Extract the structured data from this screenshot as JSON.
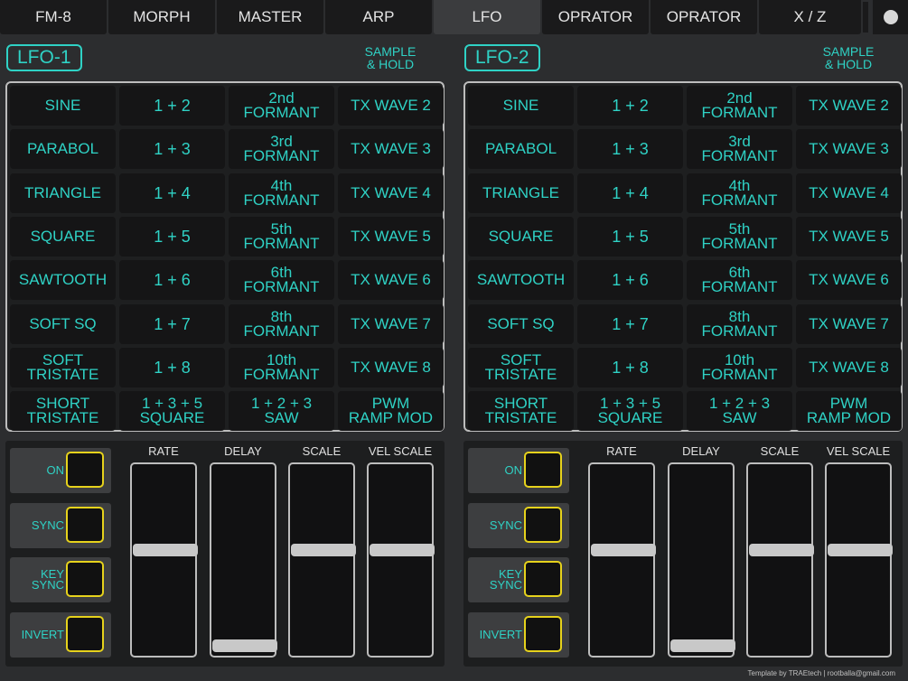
{
  "tabs": [
    {
      "label": "FM-8",
      "active": false
    },
    {
      "label": "MORPH",
      "active": false
    },
    {
      "label": "MASTER",
      "active": false
    },
    {
      "label": "ARP",
      "active": false
    },
    {
      "label": "LFO",
      "active": true
    },
    {
      "label": "OPRATOR",
      "active": false
    },
    {
      "label": "OPRATOR",
      "active": false
    },
    {
      "label": "X / Z",
      "active": false
    }
  ],
  "lfos": [
    {
      "title": "LFO-1",
      "sample_hold": [
        "SAMPLE",
        "& HOLD"
      ],
      "waves": [
        [
          [
            "SINE"
          ],
          [
            "1 + 2"
          ],
          [
            "2nd",
            "FORMANT"
          ],
          [
            "TX WAVE 2"
          ]
        ],
        [
          [
            "PARABOL"
          ],
          [
            "1 + 3"
          ],
          [
            "3rd",
            "FORMANT"
          ],
          [
            "TX WAVE 3"
          ]
        ],
        [
          [
            "TRIANGLE"
          ],
          [
            "1 + 4"
          ],
          [
            "4th",
            "FORMANT"
          ],
          [
            "TX WAVE 4"
          ]
        ],
        [
          [
            "SQUARE"
          ],
          [
            "1 + 5"
          ],
          [
            "5th",
            "FORMANT"
          ],
          [
            "TX WAVE 5"
          ]
        ],
        [
          [
            "SAWTOOTH"
          ],
          [
            "1 + 6"
          ],
          [
            "6th",
            "FORMANT"
          ],
          [
            "TX WAVE 6"
          ]
        ],
        [
          [
            "SOFT SQ"
          ],
          [
            "1 + 7"
          ],
          [
            "8th",
            "FORMANT"
          ],
          [
            "TX WAVE 7"
          ]
        ],
        [
          [
            "SOFT",
            "TRISTATE"
          ],
          [
            "1 + 8"
          ],
          [
            "10th",
            "FORMANT"
          ],
          [
            "TX WAVE 8"
          ]
        ],
        [
          [
            "SHORT",
            "TRISTATE"
          ],
          [
            "1 + 3 + 5",
            "SQUARE"
          ],
          [
            "1 + 2 + 3",
            "SAW"
          ],
          [
            "PWM",
            "RAMP MOD"
          ]
        ]
      ],
      "toggles": [
        [
          "ON"
        ],
        [
          "SYNC"
        ],
        [
          "KEY",
          "SYNC"
        ],
        [
          "INVERT"
        ]
      ],
      "sliders": [
        {
          "label": "RATE",
          "level": 0.55
        },
        {
          "label": "DELAY",
          "level": 0.0
        },
        {
          "label": "SCALE",
          "level": 0.55
        },
        {
          "label": "VEL SCALE",
          "level": 0.55
        }
      ]
    },
    {
      "title": "LFO-2",
      "sample_hold": [
        "SAMPLE",
        "& HOLD"
      ],
      "waves": [
        [
          [
            "SINE"
          ],
          [
            "1 + 2"
          ],
          [
            "2nd",
            "FORMANT"
          ],
          [
            "TX WAVE 2"
          ]
        ],
        [
          [
            "PARABOL"
          ],
          [
            "1 + 3"
          ],
          [
            "3rd",
            "FORMANT"
          ],
          [
            "TX WAVE 3"
          ]
        ],
        [
          [
            "TRIANGLE"
          ],
          [
            "1 + 4"
          ],
          [
            "4th",
            "FORMANT"
          ],
          [
            "TX WAVE 4"
          ]
        ],
        [
          [
            "SQUARE"
          ],
          [
            "1 + 5"
          ],
          [
            "5th",
            "FORMANT"
          ],
          [
            "TX WAVE 5"
          ]
        ],
        [
          [
            "SAWTOOTH"
          ],
          [
            "1 + 6"
          ],
          [
            "6th",
            "FORMANT"
          ],
          [
            "TX WAVE 6"
          ]
        ],
        [
          [
            "SOFT SQ"
          ],
          [
            "1 + 7"
          ],
          [
            "8th",
            "FORMANT"
          ],
          [
            "TX WAVE 7"
          ]
        ],
        [
          [
            "SOFT",
            "TRISTATE"
          ],
          [
            "1 + 8"
          ],
          [
            "10th",
            "FORMANT"
          ],
          [
            "TX WAVE 8"
          ]
        ],
        [
          [
            "SHORT",
            "TRISTATE"
          ],
          [
            "1 + 3 + 5",
            "SQUARE"
          ],
          [
            "1 + 2 + 3",
            "SAW"
          ],
          [
            "PWM",
            "RAMP MOD"
          ]
        ]
      ],
      "toggles": [
        [
          "ON"
        ],
        [
          "SYNC"
        ],
        [
          "KEY",
          "SYNC"
        ],
        [
          "INVERT"
        ]
      ],
      "sliders": [
        {
          "label": "RATE",
          "level": 0.55
        },
        {
          "label": "DELAY",
          "level": 0.0
        },
        {
          "label": "SCALE",
          "level": 0.55
        },
        {
          "label": "VEL SCALE",
          "level": 0.55
        }
      ]
    }
  ],
  "footer": "Template by TRAEtech | rootballa@gmail.com",
  "colors": {
    "accent": "#2fd2c5",
    "toggle_border": "#e6d21c",
    "background": "#2c2d2f"
  }
}
